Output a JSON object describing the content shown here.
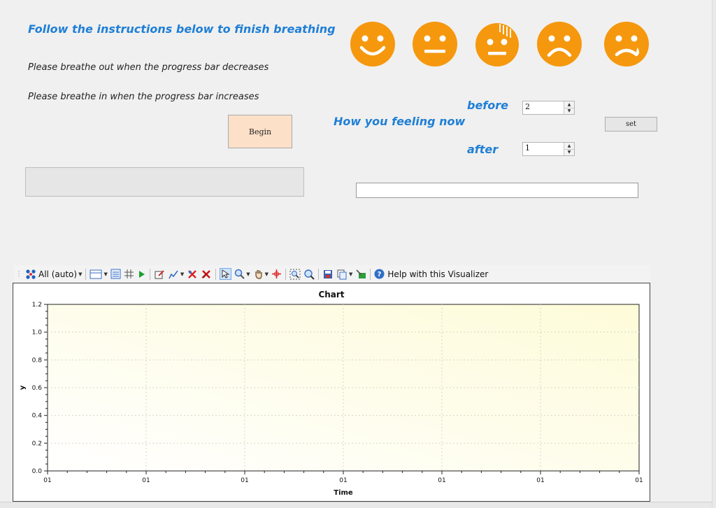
{
  "instructions": {
    "heading": "Follow the instructions below to finish breathing",
    "breathe_out": "Please breathe out when the progress bar decreases",
    "breathe_in": "Please breathe in when the progress bar increases",
    "begin_label": "Begin"
  },
  "mood": {
    "prompt": "How you feeling now",
    "before_label": "before",
    "before_value": "2",
    "after_label": "after",
    "after_value": "1",
    "set_label": "set",
    "emojis": [
      "happy-face-icon",
      "neutral-face-icon",
      "anxious-face-icon",
      "sad-face-icon",
      "crying-face-icon"
    ],
    "emoji_color": "#f5980e"
  },
  "toolbar": {
    "series_selector": "All (auto)",
    "help_label": "Help with this Visualizer"
  },
  "chart_data": {
    "type": "line",
    "title": "Chart",
    "xlabel": "Time",
    "ylabel": "y",
    "ylim": [
      0,
      1.2
    ],
    "y_ticks": [
      "0.0",
      "0.2",
      "0.4",
      "0.6",
      "0.8",
      "1.0",
      "1.2"
    ],
    "x_ticks": [
      "01",
      "01",
      "01",
      "01",
      "01",
      "01",
      "01"
    ],
    "series": [],
    "grid": true
  }
}
